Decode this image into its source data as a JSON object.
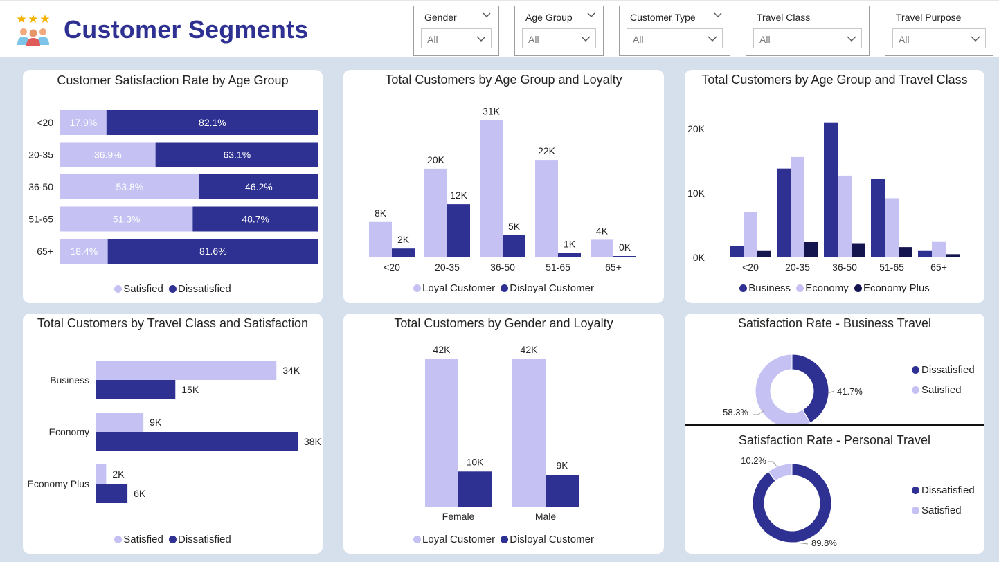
{
  "header": {
    "title": "Customer Segments",
    "logo_icon": "customer-group-stars-icon"
  },
  "slicers": [
    {
      "label": "Gender",
      "value": "All"
    },
    {
      "label": "Age Group",
      "value": "All"
    },
    {
      "label": "Customer Type",
      "value": "All"
    },
    {
      "label": "Travel Class",
      "value": "All"
    },
    {
      "label": "Travel Purpose",
      "value": "All"
    }
  ],
  "colors": {
    "light": "#c5c2f3",
    "dark": "#2e3192",
    "navy": "#14144f",
    "background": "#d6e0ec"
  },
  "chart_data": [
    {
      "id": "satisfaction_by_age",
      "type": "bar",
      "orientation": "horizontal-stacked-100",
      "title": "Customer Satisfaction Rate by Age Group",
      "categories": [
        "<20",
        "20-35",
        "36-50",
        "51-65",
        "65+"
      ],
      "series": [
        {
          "name": "Satisfied",
          "values": [
            17.9,
            36.9,
            53.8,
            51.3,
            18.4
          ],
          "labels": [
            "17.9%",
            "36.9%",
            "53.8%",
            "51.3%",
            "18.4%"
          ]
        },
        {
          "name": "Dissatisfied",
          "values": [
            82.1,
            63.1,
            46.2,
            48.7,
            81.6
          ],
          "labels": [
            "82.1%",
            "63.1%",
            "46.2%",
            "48.7%",
            "81.6%"
          ]
        }
      ],
      "legend": "bottom"
    },
    {
      "id": "age_loyalty",
      "type": "bar",
      "title": "Total Customers by Age Group and Loyalty",
      "categories": [
        "<20",
        "20-35",
        "36-50",
        "51-65",
        "65+"
      ],
      "series": [
        {
          "name": "Loyal Customer",
          "values": [
            8,
            20,
            31,
            22,
            4
          ],
          "labels": [
            "8K",
            "20K",
            "31K",
            "22K",
            "4K"
          ]
        },
        {
          "name": "Disloyal Customer",
          "values": [
            2,
            12,
            5,
            1,
            0.2
          ],
          "labels": [
            "2K",
            "12K",
            "5K",
            "1K",
            "0K"
          ]
        }
      ],
      "unit": "K",
      "ylim": [
        0,
        32
      ],
      "legend": "bottom"
    },
    {
      "id": "age_travel_class",
      "type": "bar",
      "title": "Total Customers by Age Group and Travel Class",
      "categories": [
        "<20",
        "20-35",
        "36-50",
        "51-65",
        "65+"
      ],
      "series": [
        {
          "name": "Business",
          "values": [
            1.8,
            13.8,
            21,
            12.2,
            1.1
          ]
        },
        {
          "name": "Economy",
          "values": [
            7,
            15.6,
            12.7,
            9.2,
            2.5
          ]
        },
        {
          "name": "Economy Plus",
          "values": [
            1.1,
            2.4,
            2.2,
            1.6,
            0.5
          ]
        }
      ],
      "y_ticks": [
        "0K",
        "10K",
        "20K"
      ],
      "ylim": [
        0,
        23
      ],
      "legend": "bottom"
    },
    {
      "id": "travel_class_satisfaction",
      "type": "bar",
      "orientation": "horizontal",
      "title": "Total Customers by Travel Class and Satisfaction",
      "categories": [
        "Business",
        "Economy",
        "Economy Plus"
      ],
      "series": [
        {
          "name": "Satisfied",
          "values": [
            34,
            9,
            2
          ],
          "labels": [
            "34K",
            "9K",
            "2K"
          ]
        },
        {
          "name": "Dissatisfied",
          "values": [
            15,
            38,
            6
          ],
          "labels": [
            "15K",
            "38K",
            "6K"
          ]
        }
      ],
      "xlim": [
        0,
        38
      ],
      "legend": "bottom"
    },
    {
      "id": "gender_loyalty",
      "type": "bar",
      "title": "Total Customers by Gender and Loyalty",
      "categories": [
        "Female",
        "Male"
      ],
      "series": [
        {
          "name": "Loyal Customer",
          "values": [
            42,
            42
          ],
          "labels": [
            "42K",
            "42K"
          ]
        },
        {
          "name": "Disloyal Customer",
          "values": [
            10,
            9
          ],
          "labels": [
            "10K",
            "9K"
          ]
        }
      ],
      "ylim": [
        0,
        42
      ],
      "legend": "bottom"
    },
    {
      "id": "business_travel_rate",
      "type": "pie",
      "style": "donut",
      "title": "Satisfaction Rate - Business Travel",
      "slices": [
        {
          "name": "Dissatisfied",
          "value": 41.7,
          "label": "41.7%"
        },
        {
          "name": "Satisfied",
          "value": 58.3,
          "label": "58.3%"
        }
      ],
      "legend": "right"
    },
    {
      "id": "personal_travel_rate",
      "type": "pie",
      "style": "donut",
      "title": "Satisfaction Rate - Personal Travel",
      "slices": [
        {
          "name": "Dissatisfied",
          "value": 89.8,
          "label": "89.8%"
        },
        {
          "name": "Satisfied",
          "value": 10.2,
          "label": "10.2%"
        }
      ],
      "legend": "right"
    }
  ]
}
